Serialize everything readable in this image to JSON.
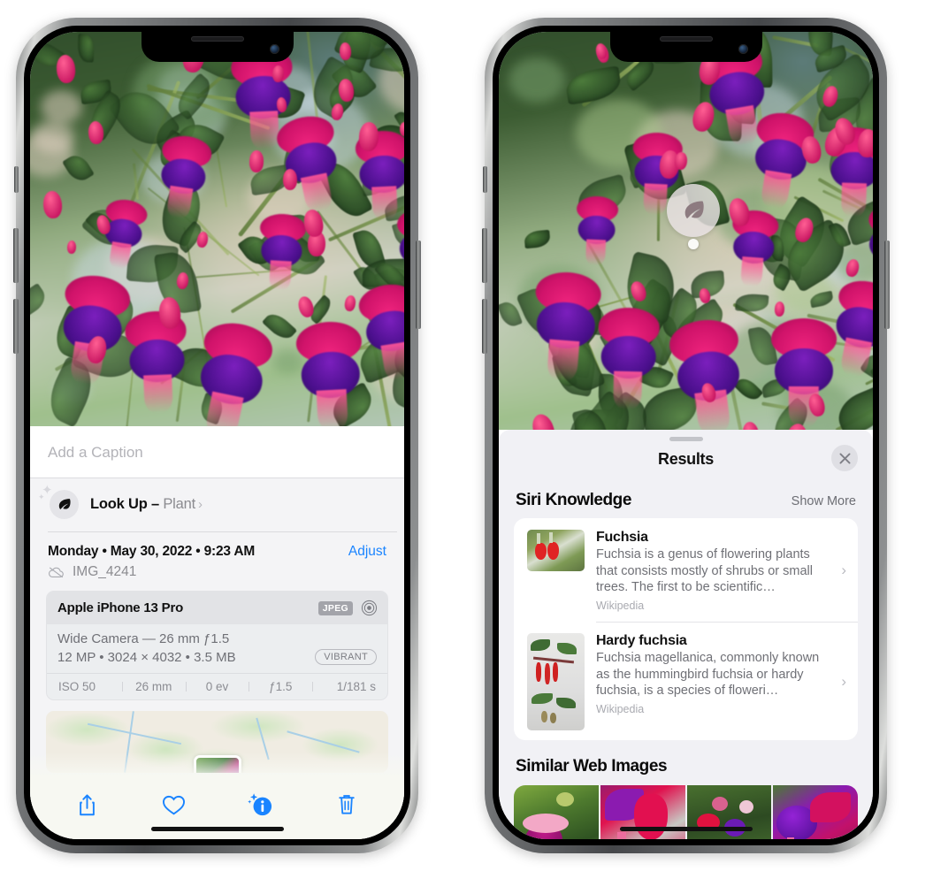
{
  "left_phone": {
    "name": "photos-detail-view",
    "caption_placeholder": "Add a Caption",
    "lookup": {
      "label": "Look Up – ",
      "subject": "Plant",
      "chevron": "›",
      "icon": "leaf-icon"
    },
    "date_line": "Monday • May 30, 2022 • 9:23 AM",
    "adjust_label": "Adjust",
    "file_name": "IMG_4241",
    "cloud_icon": "icloud-slash-icon",
    "metadata": {
      "device": "Apple iPhone 13 Pro",
      "format_badge": "JPEG",
      "aperture_icon": "raw-circles-icon",
      "lens_line": "Wide Camera — 26 mm ƒ1.5",
      "size_line": "12 MP • 3024 × 4032 • 3.5 MB",
      "profile_badge": "VIBRANT",
      "exif": [
        "ISO 50",
        "26 mm",
        "0 ev",
        "ƒ1.5",
        "1/181 s"
      ]
    },
    "toolbar": [
      {
        "name": "share-button",
        "icon": "share-icon"
      },
      {
        "name": "favorite-button",
        "icon": "heart-icon"
      },
      {
        "name": "info-button",
        "icon": "info-sparkle-icon"
      },
      {
        "name": "delete-button",
        "icon": "trash-icon"
      }
    ]
  },
  "right_phone": {
    "name": "visual-look-up-results",
    "badge_icon": "leaf-icon",
    "sheet": {
      "title": "Results",
      "close_icon": "close-icon",
      "sections": [
        {
          "name": "siri-knowledge",
          "title": "Siri Knowledge",
          "action": "Show More",
          "items": [
            {
              "title": "Fuchsia",
              "description": "Fuchsia is a genus of flowering plants that consists mostly of shrubs or small trees. The first to be scientific…",
              "source": "Wikipedia",
              "chevron": "›"
            },
            {
              "title": "Hardy fuchsia",
              "description": "Fuchsia magellanica, commonly known as the hummingbird fuchsia or hardy fuchsia, is a species of floweri…",
              "source": "Wikipedia",
              "chevron": "›"
            }
          ]
        },
        {
          "name": "similar-web-images",
          "title": "Similar Web Images",
          "thumbnails": [
            "web-image-1",
            "web-image-2",
            "web-image-3",
            "web-image-4"
          ]
        }
      ]
    }
  },
  "colors": {
    "accent_blue": "#1a84ff",
    "sheet_bg": "#f1f1f5",
    "card_bg": "#ffffff",
    "secondary_text": "#6f7076",
    "badge_gray": "#a3a4aa"
  }
}
